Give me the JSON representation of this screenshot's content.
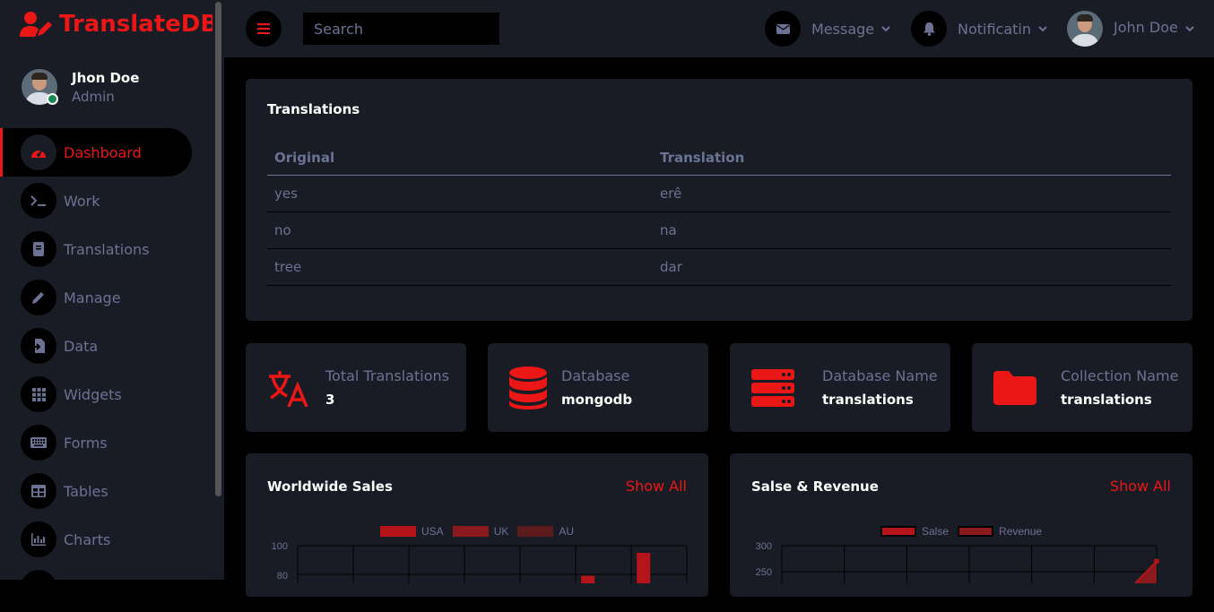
{
  "brand": {
    "name": "TranslateDB"
  },
  "profile": {
    "name": "Jhon Doe",
    "role": "Admin"
  },
  "nav": [
    {
      "label": "Dashboard",
      "icon": "tachometer-icon"
    },
    {
      "label": "Work",
      "icon": "terminal-icon"
    },
    {
      "label": "Translations",
      "icon": "book-icon"
    },
    {
      "label": "Manage",
      "icon": "pencil-icon"
    },
    {
      "label": "Data",
      "icon": "file-import-icon"
    },
    {
      "label": "Widgets",
      "icon": "grid-icon"
    },
    {
      "label": "Forms",
      "icon": "keyboard-icon"
    },
    {
      "label": "Tables",
      "icon": "table-icon"
    },
    {
      "label": "Charts",
      "icon": "chart-bar-icon"
    }
  ],
  "topbar": {
    "search_placeholder": "Search",
    "message_label": "Message",
    "notification_label": "Notificatin",
    "user_label": "John Doe"
  },
  "translations": {
    "title": "Translations",
    "headers": [
      "Original",
      "Translation"
    ],
    "rows": [
      [
        "yes",
        "erê"
      ],
      [
        "no",
        "na"
      ],
      [
        "tree",
        "dar"
      ]
    ]
  },
  "stats": [
    {
      "label": "Total Translations",
      "value": "3",
      "icon": "language-icon"
    },
    {
      "label": "Database",
      "value": "mongodb",
      "icon": "database-icon"
    },
    {
      "label": "Database Name",
      "value": "translations",
      "icon": "server-icon"
    },
    {
      "label": "Collection Name",
      "value": "translations",
      "icon": "folder-icon"
    }
  ],
  "colors": {
    "accent": "#eb1616",
    "panel": "#191c24",
    "background": "#000000",
    "muted": "#6c7293"
  },
  "chart_data": [
    {
      "type": "bar",
      "title": "Worldwide Sales",
      "action": "Show All",
      "legend": [
        "USA",
        "UK",
        "AU"
      ],
      "legend_colors": [
        "#b5151a",
        "#8a1a1e",
        "#5e1b1e"
      ],
      "y_ticks": [
        "100",
        "80"
      ],
      "ylim": [
        0,
        100
      ],
      "visible_bars": [
        {
          "column": 6,
          "series": "USA",
          "value": 79
        },
        {
          "column": 7,
          "series": "USA",
          "value": 95
        }
      ]
    },
    {
      "type": "line",
      "title": "Salse & Revenue",
      "action": "Show All",
      "legend": [
        "Salse",
        "Revenue"
      ],
      "legend_colors": [
        "#b5151a",
        "#8a1a1e"
      ],
      "y_ticks": [
        "300",
        "250"
      ],
      "ylim": [
        0,
        300
      ],
      "visible_points": [
        {
          "series": "Salse",
          "x": 7,
          "value": 270
        }
      ]
    }
  ]
}
